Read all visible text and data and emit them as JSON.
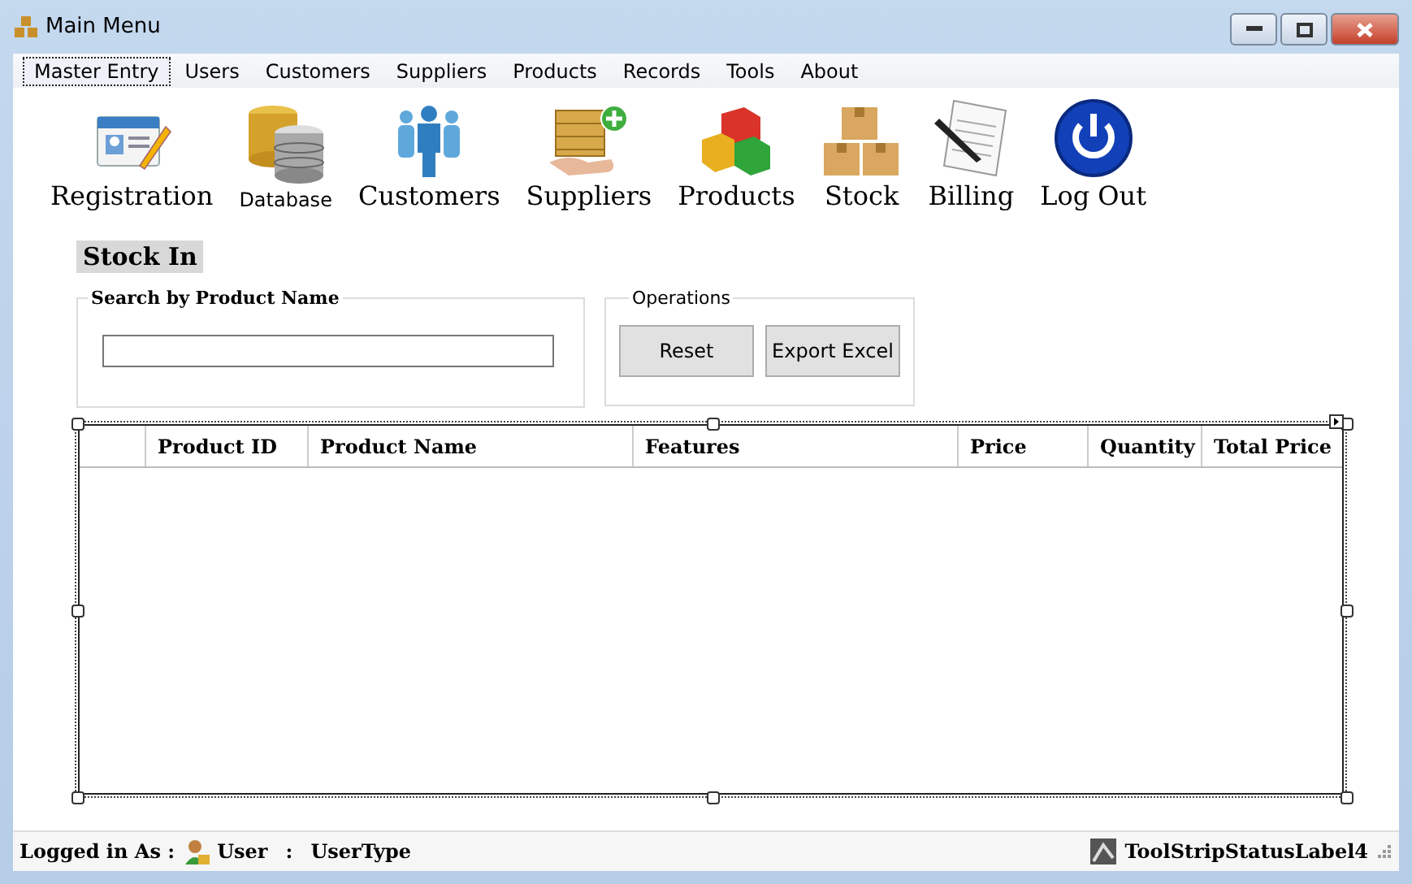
{
  "window": {
    "title": "Main Menu"
  },
  "menu": [
    {
      "label": "Master Entry",
      "selected": true
    },
    {
      "label": "Users",
      "selected": false
    },
    {
      "label": "Customers",
      "selected": false
    },
    {
      "label": "Suppliers",
      "selected": false
    },
    {
      "label": "Products",
      "selected": false
    },
    {
      "label": "Records",
      "selected": false
    },
    {
      "label": "Tools",
      "selected": false
    },
    {
      "label": "About",
      "selected": false
    }
  ],
  "toolbar": [
    {
      "kind": "registration",
      "label": "Registration"
    },
    {
      "kind": "database",
      "label": "Database"
    },
    {
      "kind": "customers",
      "label": "Customers"
    },
    {
      "kind": "suppliers",
      "label": "Suppliers"
    },
    {
      "kind": "products",
      "label": "Products"
    },
    {
      "kind": "stock",
      "label": "Stock"
    },
    {
      "kind": "billing",
      "label": "Billing"
    },
    {
      "kind": "logout",
      "label": "Log Out"
    }
  ],
  "section_title": "Stock In",
  "search_group": {
    "title": "Search by Product Name"
  },
  "operations": {
    "title": "Operations",
    "buttons": [
      "Reset",
      "Export Excel"
    ]
  },
  "table": {
    "columns": [
      "Product ID",
      "Product Name",
      "Features",
      "Price",
      "Quantity",
      "Total Price"
    ]
  },
  "status_bar": {
    "logged_in_label": "Logged in As :",
    "user": "User",
    "separator": ":",
    "user_type": "UserType",
    "right_label": "ToolStripStatusLabel4"
  }
}
